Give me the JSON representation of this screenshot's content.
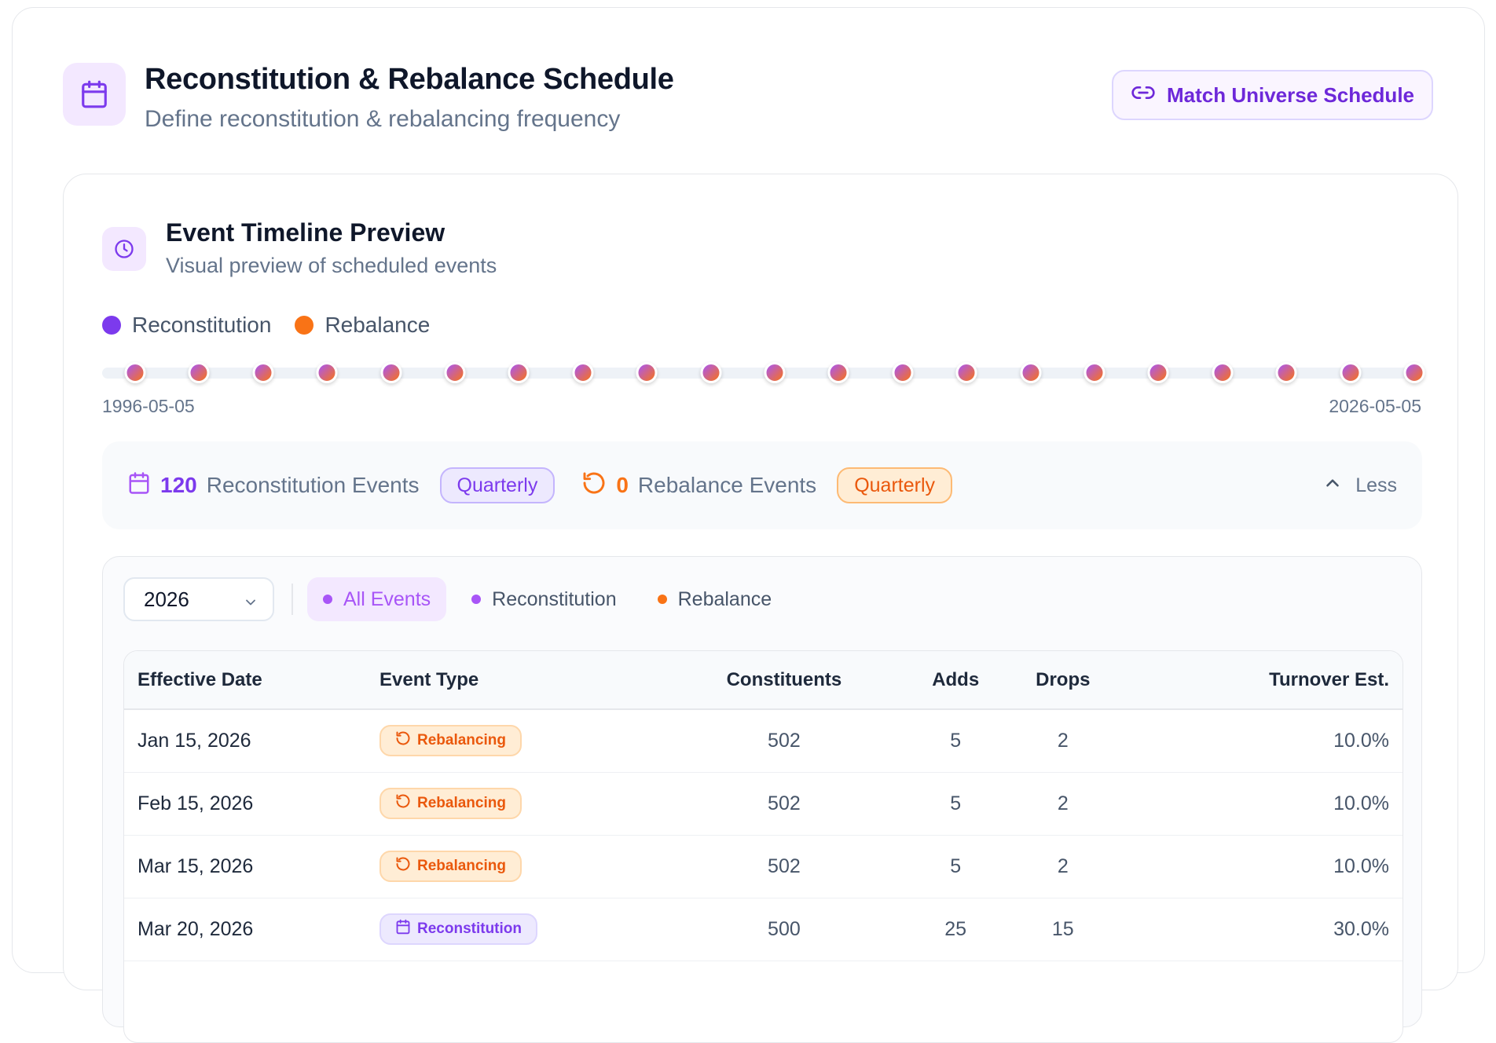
{
  "header": {
    "title": "Reconstitution & Rebalance Schedule",
    "subtitle": "Define reconstitution & rebalancing frequency",
    "icon": "calendar-icon",
    "match_button_label": "Match Universe Schedule",
    "match_button_icon": "link-icon"
  },
  "preview": {
    "title": "Event Timeline Preview",
    "subtitle": "Visual preview of scheduled events",
    "icon": "clock-icon",
    "legend": [
      {
        "label": "Reconstitution",
        "color": "#7c3aed"
      },
      {
        "label": "Rebalance",
        "color": "#f97316"
      }
    ],
    "timeline": {
      "start_label": "1996-05-05",
      "end_label": "2026-05-05",
      "event_count_shown": 21
    }
  },
  "summary": {
    "recon_count": "120",
    "recon_label": "Reconstitution Events",
    "recon_frequency": "Quarterly",
    "rebal_count": "0",
    "rebal_label": "Rebalance Events",
    "rebal_frequency": "Quarterly",
    "toggle_label": "Less"
  },
  "events": {
    "year": "2026",
    "filters": [
      {
        "label": "All Events",
        "active": true,
        "color": "#a855f7"
      },
      {
        "label": "Reconstitution",
        "active": false,
        "color": "#a855f7"
      },
      {
        "label": "Rebalance",
        "active": false,
        "color": "#f97316"
      }
    ],
    "columns": [
      "Effective Date",
      "Event Type",
      "Constituents",
      "Adds",
      "Drops",
      "Turnover Est."
    ],
    "rows": [
      {
        "date": "Jan 15, 2026",
        "type": "Rebalancing",
        "kind": "rebalance",
        "constituents": "502",
        "adds": "5",
        "drops": "2",
        "turnover": "10.0%"
      },
      {
        "date": "Feb 15, 2026",
        "type": "Rebalancing",
        "kind": "rebalance",
        "constituents": "502",
        "adds": "5",
        "drops": "2",
        "turnover": "10.0%"
      },
      {
        "date": "Mar 15, 2026",
        "type": "Rebalancing",
        "kind": "rebalance",
        "constituents": "502",
        "adds": "5",
        "drops": "2",
        "turnover": "10.0%"
      },
      {
        "date": "Mar 20, 2026",
        "type": "Reconstitution",
        "kind": "reconstitution",
        "constituents": "500",
        "adds": "25",
        "drops": "15",
        "turnover": "30.0%"
      }
    ]
  }
}
